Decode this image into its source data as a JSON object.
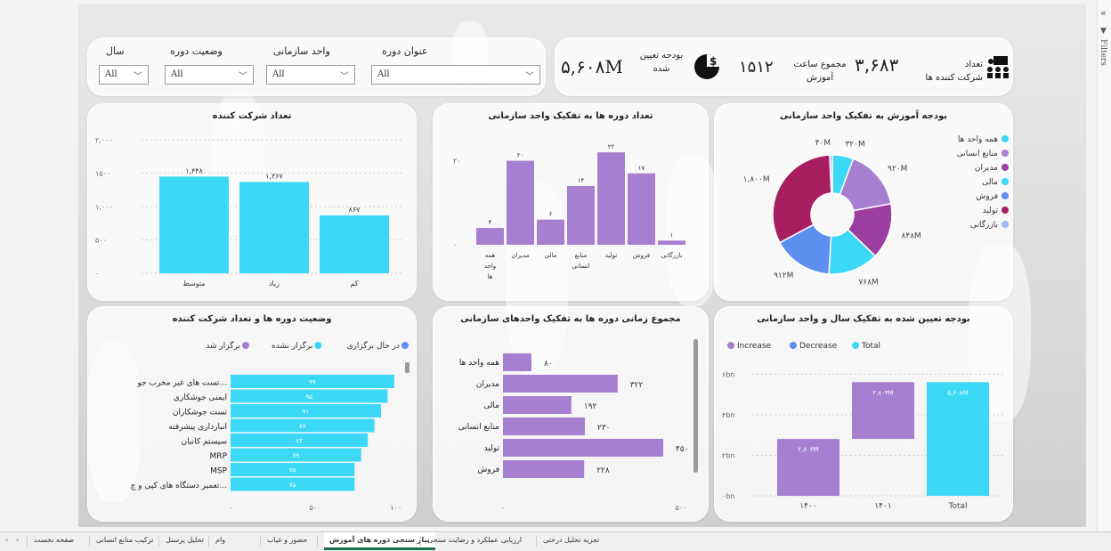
{
  "slicers": {
    "year": {
      "label": "سال",
      "value": "All"
    },
    "status": {
      "label": "وضعیت دوره",
      "value": "All"
    },
    "unit": {
      "label": "واحد سازمانی",
      "value": "All"
    },
    "course": {
      "label": "عنوان دوره",
      "value": "All"
    }
  },
  "kpi": {
    "participants_label_1": "تعداد",
    "participants_label_2": "شرکت کننده ها",
    "participants_value": "۳,۶۸۳",
    "hours_label_1": "مجموع ساعت",
    "hours_label_2": "آموزش",
    "hours_value": "۱۵۱۲",
    "budget_label_1": "بودجه تعیین",
    "budget_label_2": "شده",
    "budget_value": "۵,۶۰۸M"
  },
  "charts": {
    "participants": {
      "title": "تعداد شرکت کننده",
      "yticks": [
        "۲,۰۰۰",
        "۱۵۰۰",
        "۱,۰۰۰",
        "۵۰۰",
        "۰"
      ],
      "categories": [
        "متوسط",
        "زیاد",
        "کم"
      ],
      "values": [
        1448,
        1367,
        867
      ],
      "labels": [
        "۱,۴۴۸",
        "۱,۳۶۷",
        "۸۶۷"
      ],
      "color": "#3bd9f7",
      "ymax": 2000
    },
    "courses_by_unit": {
      "title": "تعداد دوره ها به تفکیک واحد سازمانی",
      "ytick_top": "۲۰",
      "ytick_zero": "۰",
      "categories": [
        "همه واحد ها",
        "مدیران",
        "مالی",
        "منابع انسانی",
        "تولید",
        "فروش",
        "بازرگانی"
      ],
      "values": [
        4,
        20,
        6,
        14,
        22,
        17,
        1
      ],
      "labels": [
        "۴",
        "۲۰",
        "۶",
        "۱۴",
        "۲۲",
        "۱۷",
        "۱"
      ],
      "color": "#a77fd0",
      "ymax": 25
    },
    "budget_by_unit": {
      "title": "بودجه آموزش به تفکیک واحد سازمانی",
      "legend": [
        "همه واحد ها",
        "منابع انسانی",
        "مدیران",
        "مالی",
        "فروش",
        "تولید",
        "بازرگانی"
      ],
      "colors": [
        "#3bd9f7",
        "#9b6cc9",
        "#a2358f",
        "#3bd9f7",
        "#5d8ff0",
        "#a81f61",
        "#99b8f5"
      ],
      "slices": [
        {
          "name": "همه واحد ها",
          "value": 320,
          "label": "۳۲۰M",
          "color": "#3bd9f7"
        },
        {
          "name": "منابع انسانی",
          "value": 920,
          "label": "۹۲۰M",
          "color": "#a77fd0"
        },
        {
          "name": "مدیران",
          "value": 848,
          "label": "۸۴۸M",
          "color": "#9c3ea0"
        },
        {
          "name": "مالی",
          "value": 768,
          "label": "۷۶۸M",
          "color": "#3bd9f7"
        },
        {
          "name": "فروش",
          "value": 912,
          "label": "۹۱۲M",
          "color": "#5d8ff0"
        },
        {
          "name": "تولید",
          "value": 1800,
          "label": "۱,۸۰۰M",
          "color": "#a81f61"
        },
        {
          "name": "بازرگانی",
          "value": 40,
          "label": "۴۰M",
          "color": "#99b8f5"
        }
      ]
    },
    "course_status": {
      "title": "وضعیت دوره ها و تعداد شرکت کننده",
      "legend": [
        {
          "label": "در حال برگزاری",
          "color": "#5d8ff0"
        },
        {
          "label": "برگزار نشده",
          "color": "#3bd9f7"
        },
        {
          "label": "برگزار شد",
          "color": "#a77fd0"
        }
      ],
      "categories": [
        "تست های غیر مخرب جو...",
        "ایمنی جوشکاری",
        "تست جوشکاران",
        "انبارداری پیشرفته",
        "سیستم کانبان",
        "MRP",
        "MSP",
        "تعمیر دستگاه های کپی و چ..."
      ],
      "values": [
        99,
        95,
        91,
        87,
        83,
        79,
        75,
        75
      ],
      "labels": [
        "۹۹",
        "۹۵",
        "۹۱",
        "۸۷",
        "۸۳",
        "۷۹",
        "۷۵",
        "۷۵"
      ],
      "xticks": [
        "۰",
        "۵۰",
        "۱۰۰"
      ],
      "color": "#3bd9f7",
      "xmax": 105
    },
    "hours_by_unit": {
      "title": "مجموع زمانی دوره ها به تفکیک واحدهای سازمانی",
      "categories": [
        "همه واحد ها",
        "مدیران",
        "مالی",
        "منابع انسانی",
        "تولید",
        "فروش"
      ],
      "values": [
        80,
        322,
        192,
        230,
        450,
        228
      ],
      "labels": [
        "۸۰",
        "۳۲۲",
        "۱۹۲",
        "۲۳۰",
        "۴۵۰",
        "۲۲۸"
      ],
      "xticks": [
        "۰",
        "۵۰۰"
      ],
      "color": "#a77fd0",
      "xmax": 500
    },
    "budget_waterfall": {
      "title": "بودجه تعیین شده به تفکیک سال و واحد سازمانی",
      "legend": [
        {
          "label": "Increase",
          "color": "#a77fd0"
        },
        {
          "label": "Decrease",
          "color": "#5d8ff0"
        },
        {
          "label": "Total",
          "color": "#3bd9f7"
        }
      ],
      "yticks": [
        "۶bn",
        "۴bn",
        "۲bn",
        "۰bn"
      ],
      "categories": [
        "۱۴۰۰",
        "۱۴۰۱",
        "Total"
      ],
      "bars": [
        {
          "start": 0,
          "end": 2.804,
          "label": "۲,۸۰۴M",
          "color": "#a77fd0"
        },
        {
          "start": 2.804,
          "end": 5.608,
          "label": "۲,۸۰۴M",
          "color": "#a77fd0"
        },
        {
          "start": 0,
          "end": 5.608,
          "label": "۵,۶۰۸M",
          "color": "#3bd9f7"
        }
      ],
      "ymax": 6.5
    }
  },
  "tabs": [
    {
      "label": "صفحه نخست"
    },
    {
      "label": "ترکیب منابع انسانی"
    },
    {
      "label": "تحلیل پرسنل"
    },
    {
      "label": "وام"
    },
    {
      "label": "حضور و غیاب"
    },
    {
      "label": "نیاز سنجی دوره های آموزش",
      "active": true
    },
    {
      "label": "ارزیابی عملکرد و رضایت سنجی"
    },
    {
      "label": "تجزیه تحلیل درختی"
    }
  ],
  "filters_pane": {
    "label": "Filters",
    "collapse": "«"
  }
}
